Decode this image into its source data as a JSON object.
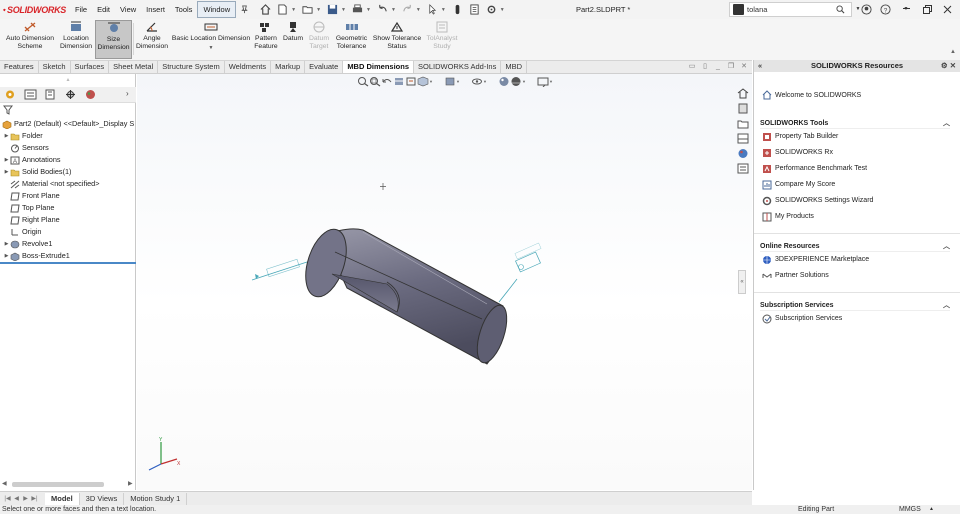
{
  "app": {
    "logo_text": "SOLIDWORKS",
    "document_title": "Part2.SLDPRT *",
    "menus": [
      "File",
      "Edit",
      "View",
      "Insert",
      "Tools",
      "Window"
    ],
    "search": {
      "value": "tolana"
    }
  },
  "ribbon": {
    "buttons": [
      {
        "label": "Auto Dimension\nScheme"
      },
      {
        "label": "Location\nDimension"
      },
      {
        "label": "Size\nDimension"
      },
      {
        "label": "Angle\nDimension"
      },
      {
        "label": "Basic Location Dimension"
      },
      {
        "label": "Pattern\nFeature"
      },
      {
        "label": "Datum"
      },
      {
        "label": "Datum\nTarget"
      },
      {
        "label": "Geometric\nTolerance"
      },
      {
        "label": "Show Tolerance\nStatus"
      },
      {
        "label": "TolAnalyst\nStudy"
      }
    ]
  },
  "cm_tabs": [
    "Features",
    "Sketch",
    "Surfaces",
    "Sheet Metal",
    "Structure System",
    "Weldments",
    "Markup",
    "Evaluate",
    "MBD Dimensions",
    "SOLIDWORKS Add-Ins",
    "MBD"
  ],
  "cm_active": "MBD Dimensions",
  "tree": {
    "root": "Part2 (Default) <<Default>_Display S",
    "items": [
      {
        "label": "Folder"
      },
      {
        "label": "Sensors"
      },
      {
        "label": "Annotations"
      },
      {
        "label": "Solid Bodies(1)"
      },
      {
        "label": "Material <not specified>"
      },
      {
        "label": "Front Plane"
      },
      {
        "label": "Top Plane"
      },
      {
        "label": "Right Plane"
      },
      {
        "label": "Origin"
      },
      {
        "label": "Revolve1"
      },
      {
        "label": "Boss-Extrude1"
      }
    ]
  },
  "resources": {
    "title": "SOLIDWORKS Resources",
    "welcome": "Welcome to SOLIDWORKS",
    "sections": [
      {
        "title": "SOLIDWORKS Tools",
        "links": [
          "Property Tab Builder",
          "SOLIDWORKS Rx",
          "Performance Benchmark Test",
          "Compare My Score",
          "SOLIDWORKS Settings Wizard",
          "My Products"
        ]
      },
      {
        "title": "Online Resources",
        "links": [
          "3DEXPERIENCE Marketplace",
          "Partner Solutions"
        ]
      },
      {
        "title": "Subscription Services",
        "links": [
          "Subscription Services"
        ]
      }
    ]
  },
  "bottom_tabs": [
    "Model",
    "3D Views",
    "Motion Study 1"
  ],
  "bottom_active": "Model",
  "status": {
    "message": "Select one or more faces and then a text location.",
    "mode": "Editing Part",
    "units": "MMGS"
  },
  "colors": {
    "brand_red": "#d9252a",
    "accent_blue": "#4a88c7",
    "part_body": "#6b6b80",
    "annotation_teal": "#4aa8b8"
  }
}
